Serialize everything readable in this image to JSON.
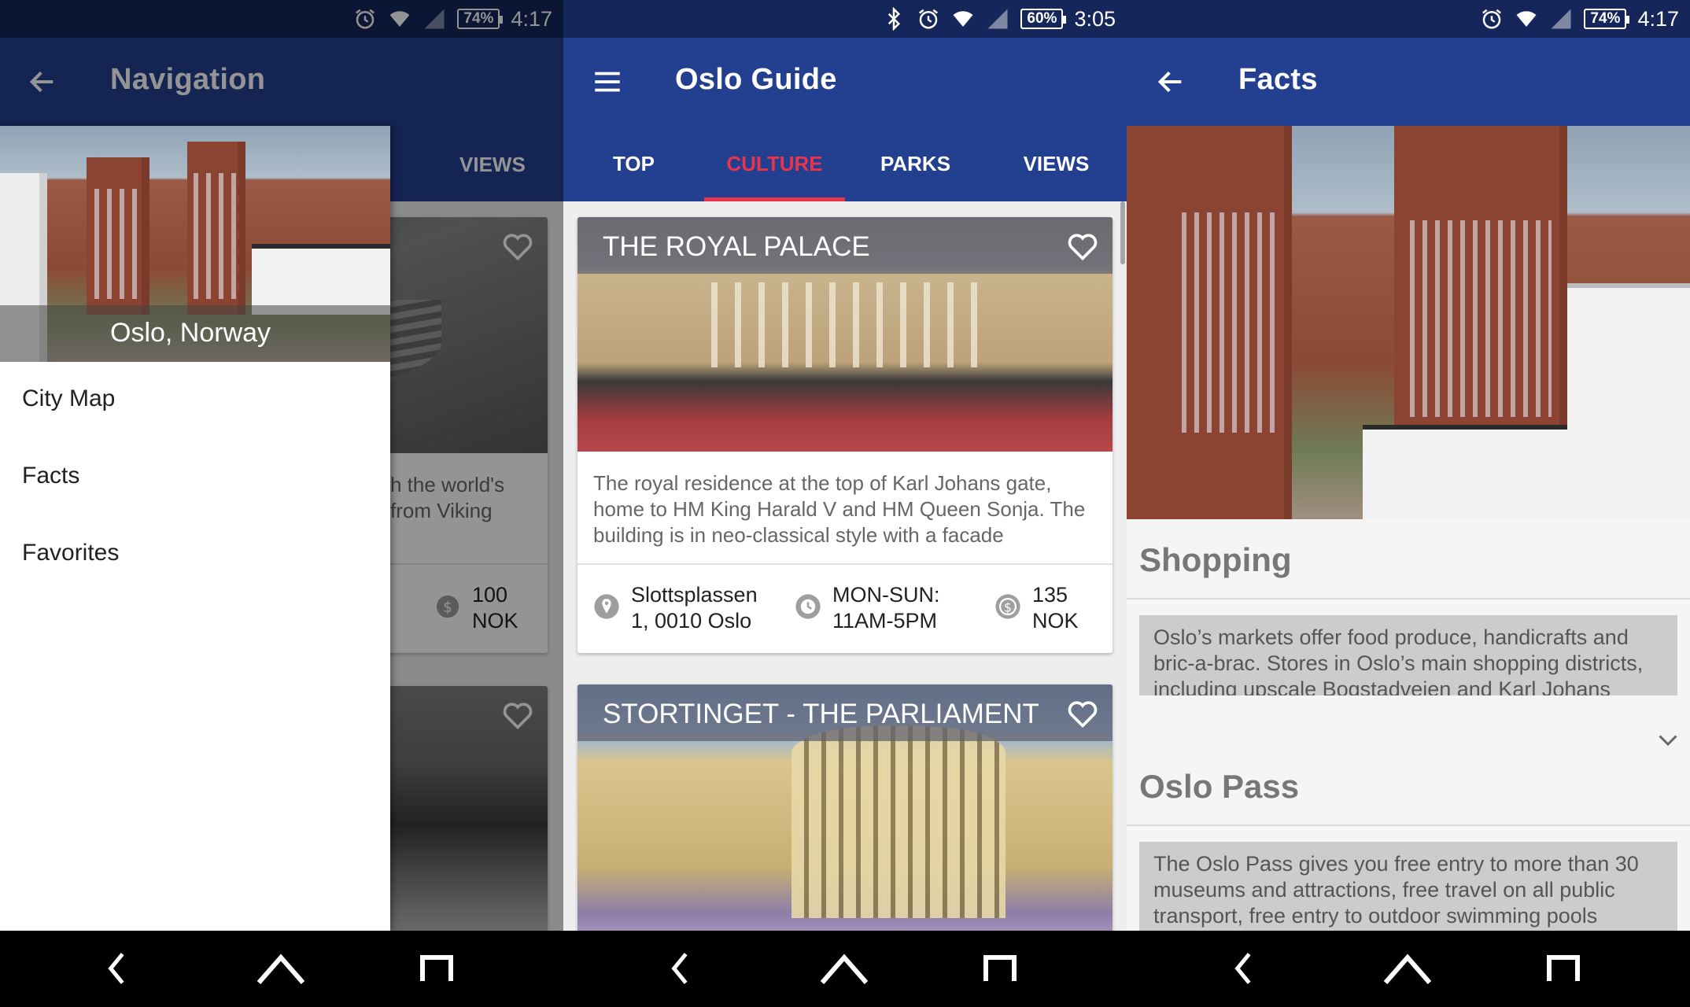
{
  "screens": {
    "navigation": {
      "status": {
        "battery": "74%",
        "time": "4:17"
      },
      "title": "Navigation",
      "behind": {
        "tab_views": "VIEWS",
        "card1_desc": "h the world's\n from Viking",
        "card1_price": "100\nNOK"
      },
      "drawer": {
        "location": "Oslo, Norway",
        "items": [
          {
            "label": "City Map"
          },
          {
            "label": "Facts"
          },
          {
            "label": "Favorites"
          }
        ]
      }
    },
    "guide": {
      "status": {
        "battery": "60%",
        "time": "3:05"
      },
      "title": "Oslo Guide",
      "tabs": [
        {
          "label": "TOP"
        },
        {
          "label": "CULTURE",
          "active": true
        },
        {
          "label": "PARKS"
        },
        {
          "label": "VIEWS"
        }
      ],
      "cards": [
        {
          "title": "THE ROYAL PALACE",
          "description": "The royal residence at the top of Karl Johans gate, home to HM King Harald V and HM Queen Sonja. The building is in neo-classical style with a facade",
          "address": "Slottsplassen\n1, 0010 Oslo",
          "hours": "MON-SUN:\n11AM-5PM",
          "price": "135\nNOK"
        },
        {
          "title": "STORTINGET - THE PARLIAMENT"
        }
      ]
    },
    "facts": {
      "status": {
        "battery": "74%",
        "time": "4:17"
      },
      "title": "Facts",
      "sections": [
        {
          "title": "Shopping",
          "text": "Oslo’s markets offer food produce, handicrafts and bric-a-brac. Stores in Oslo’s main shopping districts, including upscale Bogstadveien and Karl Johans"
        },
        {
          "title": "Oslo Pass",
          "text": "The Oslo Pass gives you free entry to more than 30 museums and attractions, free travel on all public transport, free entry to outdoor swimming pools"
        }
      ]
    }
  },
  "icons": {
    "back": "arrow-left-icon",
    "menu": "hamburger-menu-icon",
    "favorite": "heart-outline-icon",
    "location": "map-pin-icon",
    "clock": "clock-icon",
    "price": "dollar-coin-icon",
    "expand": "chevron-down-icon",
    "nav_back": "nav-back-icon",
    "nav_home": "nav-home-icon",
    "nav_recents": "nav-recents-icon"
  },
  "colors": {
    "status_bar": "#14265a",
    "app_bar": "#233f8f",
    "accent": "#e8354b"
  }
}
